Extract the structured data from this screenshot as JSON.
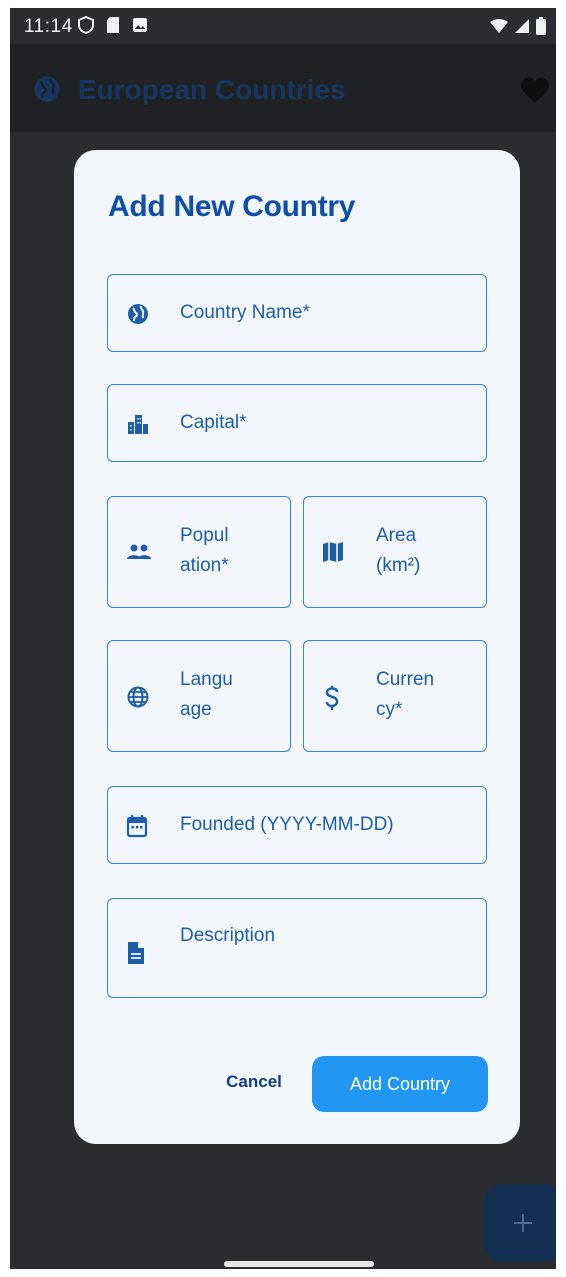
{
  "status_bar": {
    "time": "11:14"
  },
  "app_bar": {
    "title": "European Countries"
  },
  "dialog": {
    "title": "Add New Country",
    "fields": {
      "country_name": "Country Name*",
      "capital": "Capital*",
      "population": [
        "Popul",
        "ation*"
      ],
      "area": [
        "Area",
        "(km²)"
      ],
      "language": [
        "Langu",
        "age"
      ],
      "currency": [
        "Curren",
        "cy*"
      ],
      "founded": "Founded (YYYY-MM-DD)",
      "description": "Description"
    },
    "cancel_label": "Cancel",
    "add_label": "Add Country"
  },
  "colors": {
    "accent": "#2196f3",
    "title": "#0f4fa8",
    "label": "#1d5ea6",
    "scrim": "#2b2d30"
  }
}
